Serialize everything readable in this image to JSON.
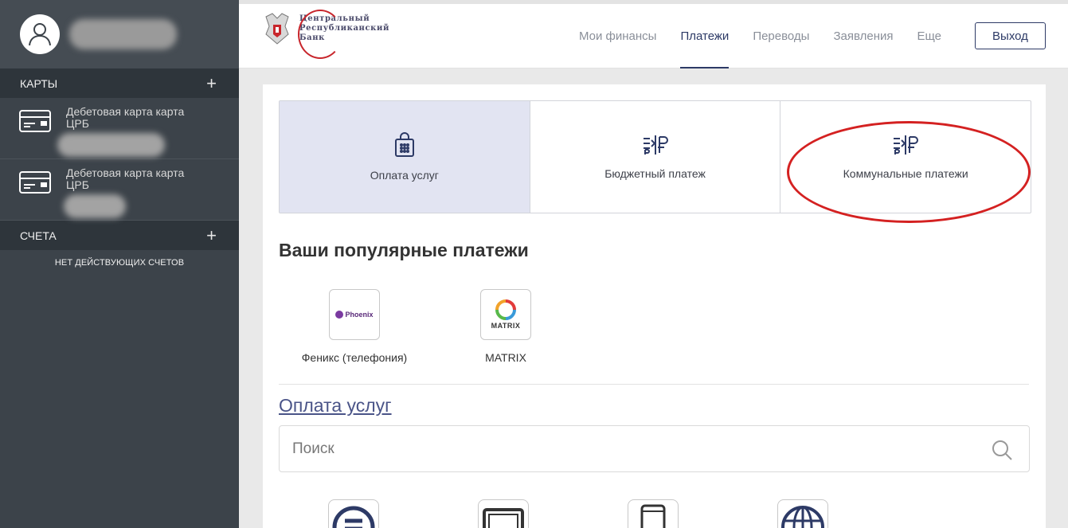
{
  "sidebar": {
    "cards_header": "КАРТЫ",
    "cards": [
      {
        "label": "Дебетовая карта карта ЦРБ"
      },
      {
        "label": "Дебетовая карта карта ЦРБ"
      }
    ],
    "accounts_header": "СЧЕТА",
    "accounts_empty": "НЕТ ДЕЙСТВУЮЩИХ СЧЕТОВ"
  },
  "header": {
    "logo_line1": "Центральный",
    "logo_line2": "Республиканский",
    "logo_line3": "Банк",
    "nav": [
      "Мои финансы",
      "Платежи",
      "Переводы",
      "Заявления",
      "Еще"
    ],
    "active_nav": "Платежи",
    "logout_label": "Выход"
  },
  "payment_types": [
    {
      "label": "Оплата услуг",
      "icon": "shopping-bag-icon",
      "active": true
    },
    {
      "label": "Бюджетный платеж",
      "icon": "transfer-ruble-icon",
      "active": false
    },
    {
      "label": "Коммунальные платежи",
      "icon": "transfer-ruble-icon",
      "active": false,
      "highlighted": true
    }
  ],
  "popular": {
    "title": "Ваши популярные платежи",
    "items": [
      {
        "label": "Феникс (телефония)",
        "logo_text": "Phoenix"
      },
      {
        "label": "MATRIX",
        "logo_text": "MATRIX"
      }
    ]
  },
  "services": {
    "title": "Оплата услуг",
    "search_placeholder": "Поиск",
    "icons": [
      "list-icon",
      "tv-icon",
      "mobile-phone-icon",
      "globe-icon"
    ]
  },
  "colors": {
    "sidebar_bg": "#3c434a",
    "accent": "#2d3a66",
    "highlight_ellipse": "#d42121",
    "active_tile_bg": "#e2e4f2"
  }
}
